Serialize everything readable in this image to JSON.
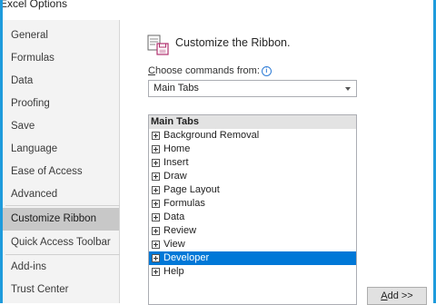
{
  "window": {
    "title": "Excel Options"
  },
  "sidebar": {
    "items": [
      {
        "label": "General"
      },
      {
        "label": "Formulas"
      },
      {
        "label": "Data"
      },
      {
        "label": "Proofing"
      },
      {
        "label": "Save"
      },
      {
        "label": "Language"
      },
      {
        "label": "Ease of Access"
      },
      {
        "label": "Advanced"
      },
      {
        "label": "Customize Ribbon"
      },
      {
        "label": "Quick Access Toolbar"
      },
      {
        "label": "Add-ins"
      },
      {
        "label": "Trust Center"
      }
    ],
    "active": "Customize Ribbon"
  },
  "main": {
    "title": "Customize the Ribbon.",
    "choose_label_first": "C",
    "choose_label_rest": "hoose commands from:",
    "info_icon": "i",
    "dropdown_value": "Main Tabs",
    "list": {
      "header": "Main Tabs",
      "items": [
        {
          "label": "Background Removal"
        },
        {
          "label": "Home"
        },
        {
          "label": "Insert"
        },
        {
          "label": "Draw"
        },
        {
          "label": "Page Layout"
        },
        {
          "label": "Formulas"
        },
        {
          "label": "Data"
        },
        {
          "label": "Review"
        },
        {
          "label": "View"
        },
        {
          "label": "Developer"
        },
        {
          "label": "Help"
        }
      ],
      "selected": "Developer"
    },
    "add_button_first": "A",
    "add_button_rest": "dd >>"
  },
  "colors": {
    "accent": "#1e9bdc",
    "selection": "#0078d7",
    "sidebar_active": "#c8c8c8"
  }
}
